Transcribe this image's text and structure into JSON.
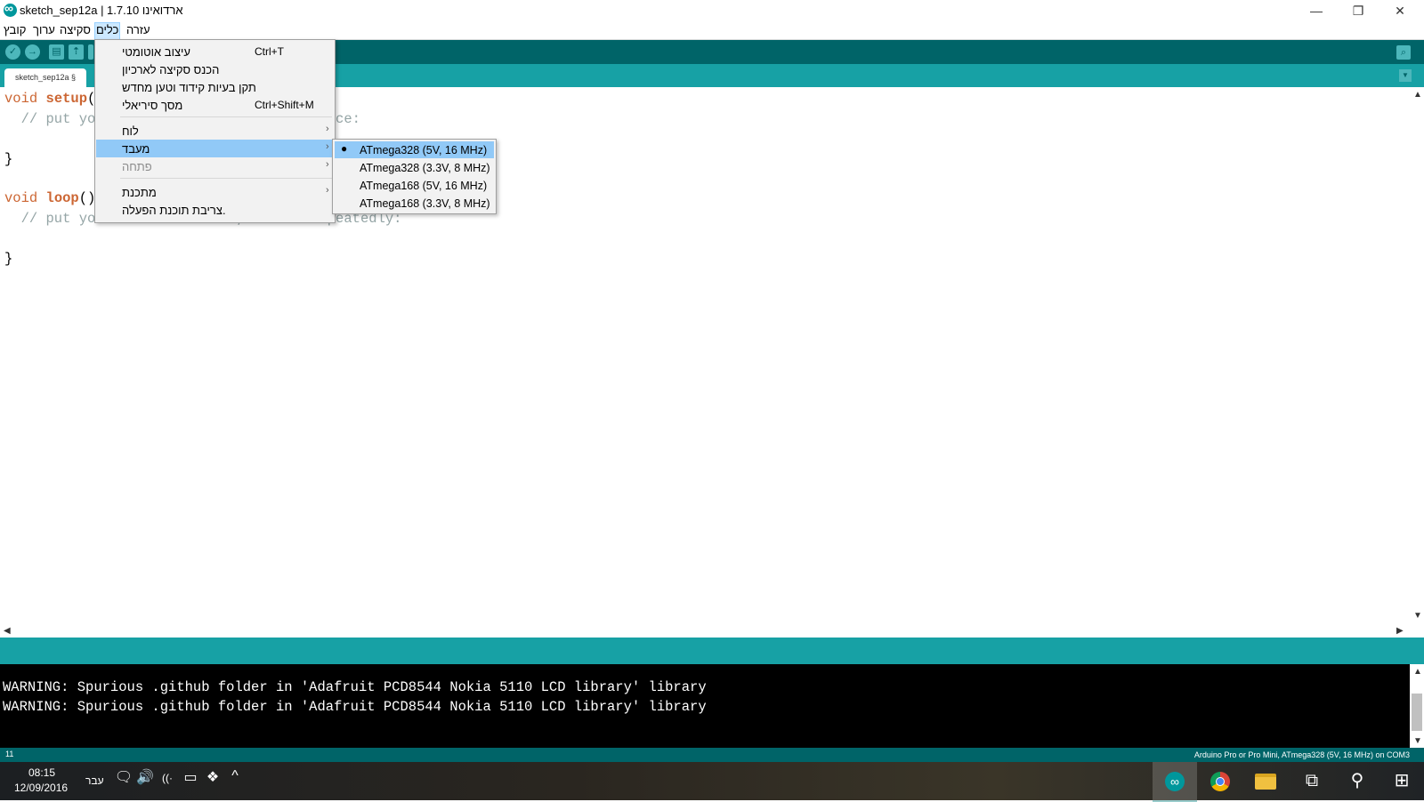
{
  "window": {
    "title": "sketch_sep12a | 1.7.10 ארדואינו",
    "minimize": "—",
    "restore": "❐",
    "close": "✕"
  },
  "menubar": {
    "file": "קובץ",
    "edit": "ערוך",
    "sketch": "סקיצה",
    "tools": "כלים",
    "help": "עזרה"
  },
  "toolbar": {
    "verify_icon": "✓",
    "upload_icon": "→",
    "new_icon": "▤",
    "open_icon": "⇡",
    "serial_icon": "⌕"
  },
  "tabs": {
    "sketch": "sketch_sep12a §",
    "dropdown": "▼"
  },
  "editor": {
    "lines": [
      {
        "pre": "",
        "kw": "void",
        "fn": "setup",
        "post": "() {"
      },
      {
        "comment": "  // put your setup code here, to run once:"
      },
      {
        "text": ""
      },
      {
        "text": "}"
      },
      {
        "text": ""
      },
      {
        "pre": "",
        "kw": "void",
        "fn": "loop",
        "post": "() {"
      },
      {
        "comment": "  // put your main code here, to run repeatedly:"
      },
      {
        "text": ""
      },
      {
        "text": "}"
      }
    ],
    "line1_kw": "void",
    "line1_fn": "setup",
    "line1_rest": "() {",
    "line2": "  // put your setup code here, to run once:",
    "line4": "}",
    "line6_kw": "void",
    "line6_fn": "loop",
    "line6_rest": "() {",
    "line7": "  // put your main code here, to run repeatedly:",
    "line9": "}"
  },
  "scroll": {
    "up": "▲",
    "down": "▼",
    "left": "◀",
    "right": "▶"
  },
  "tools_menu": {
    "items": [
      {
        "label": "עיצוב אוטומטי",
        "shortcut": "Ctrl+T"
      },
      {
        "label": "הכנס סקיצה לארכיון",
        "shortcut": ""
      },
      {
        "label": "תקן בעיות קידוד וטען מחדש",
        "shortcut": ""
      },
      {
        "label": "מסך סיריאלי",
        "shortcut": "Ctrl+Shift+M"
      },
      {
        "label": "לוח",
        "submenu": "›"
      },
      {
        "label": "מעבד",
        "submenu": "›"
      },
      {
        "label": "פתחה",
        "submenu": "›"
      },
      {
        "label": "מתכנת",
        "submenu": "›"
      },
      {
        "label": "צריבת תוכנת הפעלה.",
        "shortcut": ""
      }
    ]
  },
  "processor_menu": {
    "selected_bullet": "●",
    "items": [
      "ATmega328 (5V, 16 MHz)",
      "ATmega328 (3.3V, 8 MHz)",
      "ATmega168 (5V, 16 MHz)",
      "ATmega168 (3.3V, 8 MHz)"
    ]
  },
  "console": {
    "lines": [
      "WARNING: Spurious .github folder in 'Adafruit PCD8544 Nokia 5110 LCD library' library",
      "WARNING: Spurious .github folder in 'Adafruit PCD8544 Nokia 5110 LCD library' library"
    ]
  },
  "footer": {
    "line_number": "11",
    "board_info": "Arduino Pro or Pro Mini, ATmega328 (5V, 16 MHz) on COM3"
  },
  "taskbar": {
    "time": "08:15",
    "date": "12/09/2016",
    "language": "עבר",
    "notification_icon": "🗨",
    "volume_icon": "🔊",
    "wifi_icon": "((·",
    "battery_icon": "▭",
    "dropbox_icon": "❖",
    "chevron_icon": "^",
    "task_view_icon": "⧉",
    "search_icon": "⚲",
    "start_icon": "⊞",
    "arduino_icon": "∞"
  },
  "colors": {
    "toolbar_dark": "#006468",
    "tabbar_teal": "#17a1a5",
    "keyword_orange": "#cc6633",
    "comment_gray": "#95a5a6",
    "menu_highlight": "#91c9f7"
  }
}
